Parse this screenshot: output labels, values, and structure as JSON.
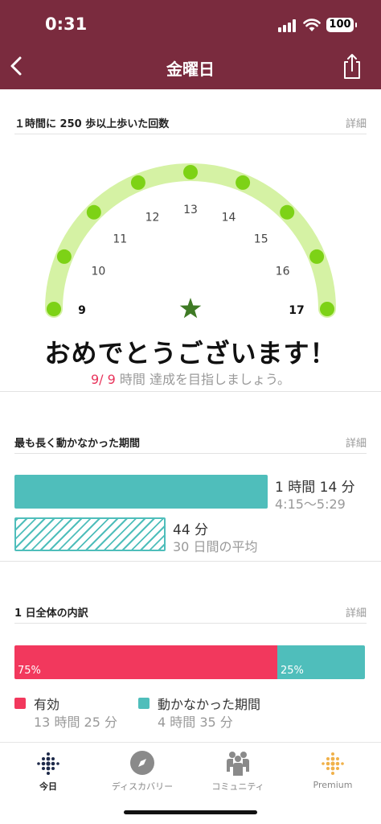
{
  "status_bar": {
    "time": "0:31",
    "battery": "100"
  },
  "nav": {
    "title": "金曜日"
  },
  "hourly": {
    "title": "１時間に 250 歩以上歩いた回数",
    "detail_label": "詳細",
    "start_label": "9",
    "end_label": "17",
    "hour_labels": [
      "10",
      "11",
      "12",
      "13",
      "14",
      "15",
      "16"
    ],
    "congrats": "おめでとうございます！",
    "goal_count": "9/ 9",
    "goal_text": "時間 達成を目指しましょう。",
    "colors": {
      "track": "#d5f2a4",
      "dot": "#7dd216",
      "star": "#3f7a25"
    }
  },
  "sedentary": {
    "title": "最も長く動かなかった期間",
    "detail_label": "詳細",
    "longest": {
      "duration": "1 時間 14 分",
      "range": "4:15～5:29",
      "fraction": 0.72
    },
    "average": {
      "duration": "44 分",
      "label": "30 日間の平均",
      "fraction": 0.43
    },
    "color": "#4fbebb"
  },
  "breakdown": {
    "title": "1 日全体の内訳",
    "detail_label": "詳細",
    "segments": [
      {
        "pct": "75%",
        "value": 75,
        "color": "#f2385d"
      },
      {
        "pct": "25%",
        "value": 25,
        "color": "#4fbebb"
      }
    ],
    "legend": [
      {
        "label": "有効",
        "value": "13 時間 25 分",
        "color": "#f2385d"
      },
      {
        "label": "動かなかった期間",
        "value": "4 時間 35 分",
        "color": "#4fbebb"
      }
    ]
  },
  "tabs": [
    {
      "label": "今日",
      "icon": "dots-grid-icon",
      "active": true
    },
    {
      "label": "ディスカバリー",
      "icon": "compass-icon",
      "active": false
    },
    {
      "label": "コミュニティ",
      "icon": "community-icon",
      "active": false
    },
    {
      "label": "Premium",
      "icon": "premium-dots-icon",
      "active": false
    }
  ]
}
